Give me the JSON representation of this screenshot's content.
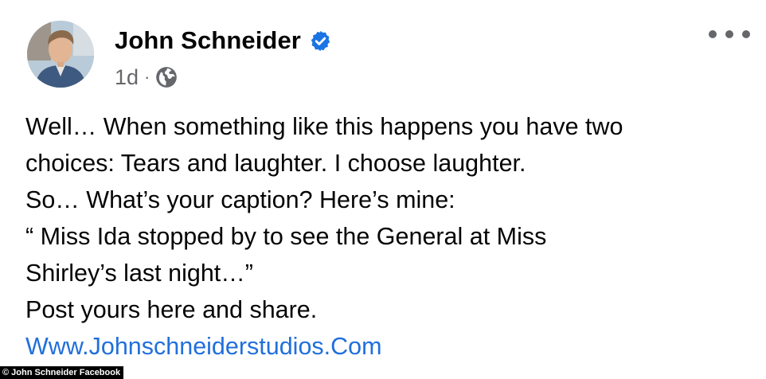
{
  "post": {
    "author_name": "John Schneider",
    "verified_icon": "verified-badge-icon",
    "timestamp": "1d",
    "separator": "·",
    "audience_icon": "globe-icon",
    "more_icon": "more-options-icon",
    "lines": [
      "Well… When something like this happens you have two",
      "choices: Tears and laughter. I choose laughter.",
      "So… What’s your caption? Here’s mine:",
      "“ Miss Ida stopped by to see the General at Miss",
      "Shirley’s last night…”",
      "Post yours here and share."
    ],
    "link_text": "Www.Johnschneiderstudios.Com"
  },
  "colors": {
    "verified_blue": "#1b74e4",
    "link_blue": "#216fdb",
    "meta_gray": "#65676b",
    "text": "#050505"
  },
  "watermark": {
    "text": "© John Schneider Facebook"
  }
}
